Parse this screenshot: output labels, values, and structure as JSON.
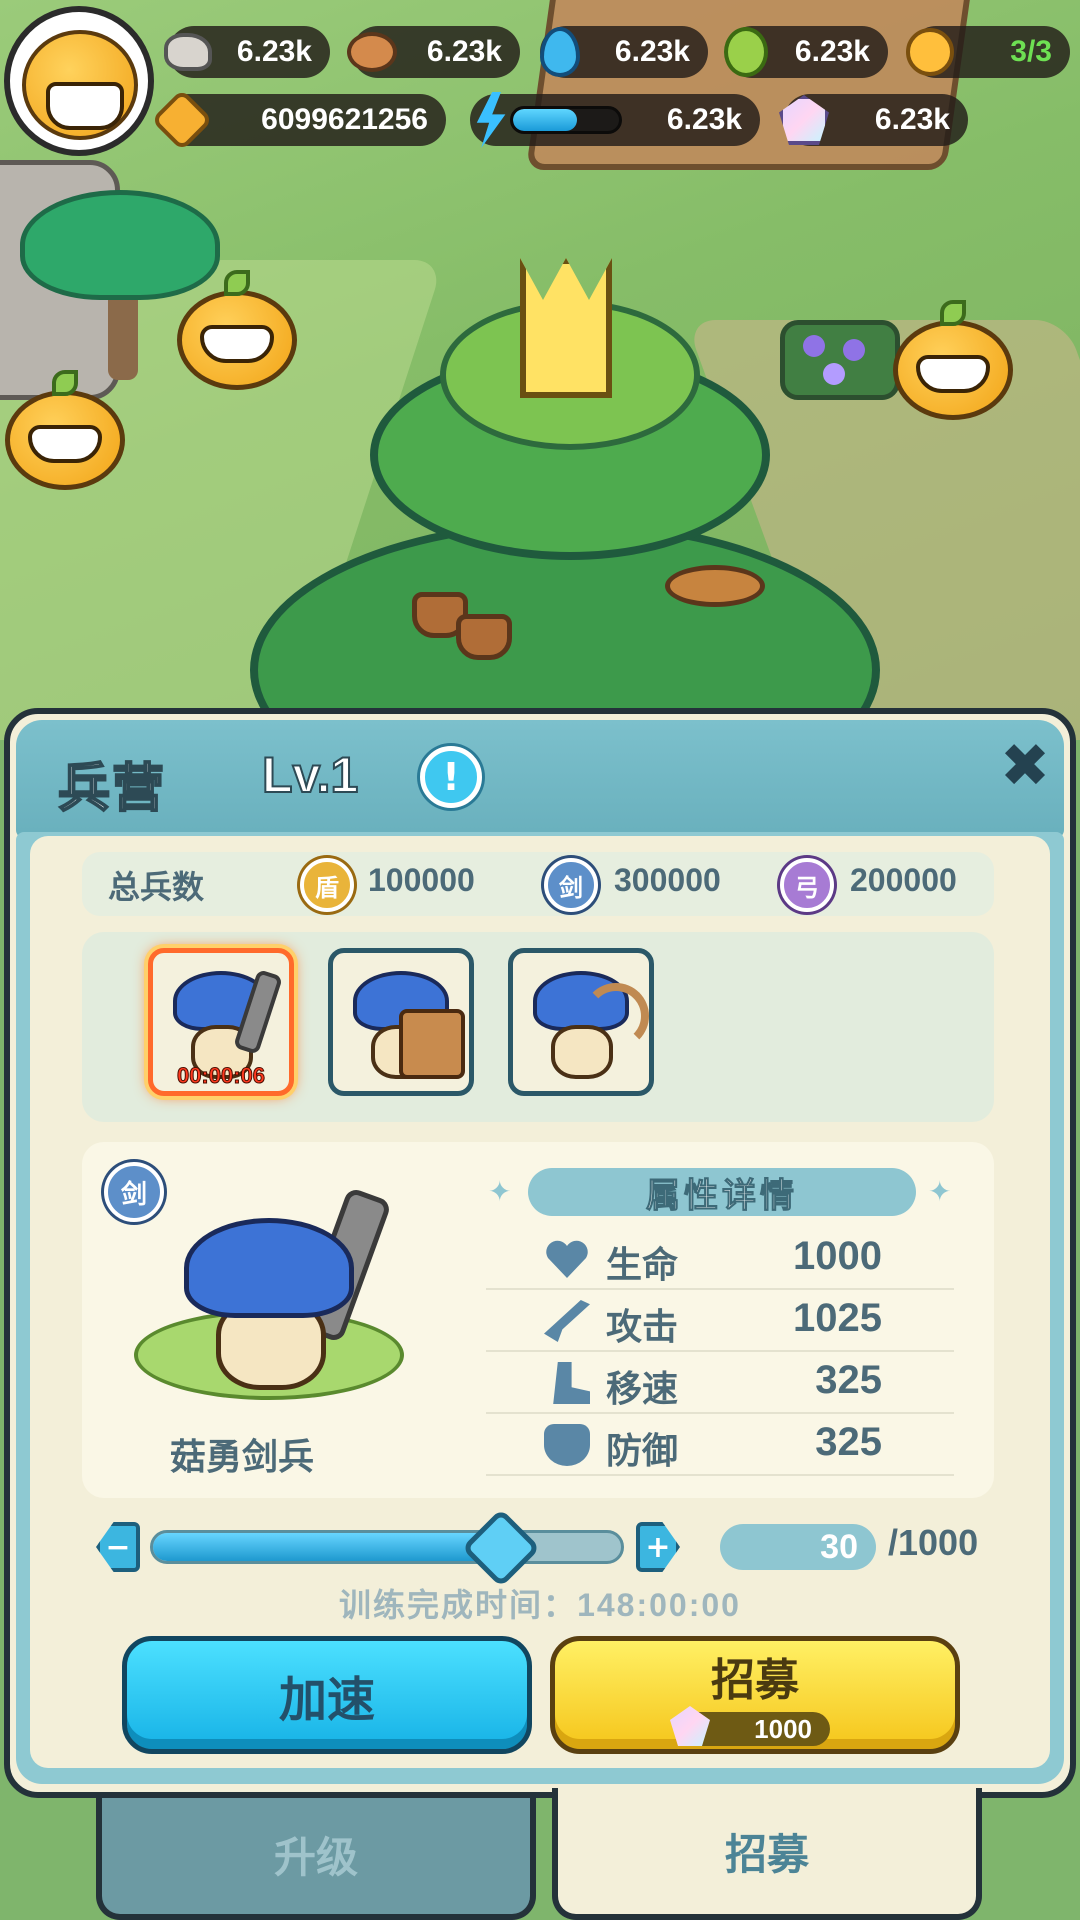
{
  "hud": {
    "resources": [
      {
        "icon": "stone-icon",
        "value": "6.23k"
      },
      {
        "icon": "wood-icon",
        "value": "6.23k"
      },
      {
        "icon": "water-drop-icon",
        "value": "6.23k"
      },
      {
        "icon": "bean-icon",
        "value": "6.23k"
      },
      {
        "icon": "population-icon",
        "value": "3/3"
      }
    ],
    "power": {
      "icon": "crossed-axe-icon",
      "value": "6099621256"
    },
    "energy": {
      "icon": "lightning-icon",
      "value": "6.23k",
      "fill_fraction": 0.6
    },
    "gems": {
      "icon": "gem-icon",
      "value": "6.23k"
    }
  },
  "panel": {
    "title": "兵营",
    "level": "Lv.1",
    "info_glyph": "!",
    "close_glyph": "✖",
    "totals": {
      "label": "总兵数",
      "shield": {
        "badge": "盾",
        "value": "100000"
      },
      "sword": {
        "badge": "剑",
        "value": "300000"
      },
      "bow": {
        "badge": "弓",
        "value": "200000"
      }
    },
    "units": [
      {
        "type": "sword",
        "selected": true,
        "timer": "00:00:06"
      },
      {
        "type": "shield",
        "selected": false
      },
      {
        "type": "bow",
        "selected": false
      }
    ],
    "detail": {
      "type_badge": "剑",
      "unit_name": "菇勇剑兵",
      "attr_title": "属性详情",
      "attributes": [
        {
          "icon": "heart-icon",
          "label": "生命",
          "value": "1000"
        },
        {
          "icon": "sword-icon",
          "label": "攻击",
          "value": "1025"
        },
        {
          "icon": "boot-icon",
          "label": "移速",
          "value": "325"
        },
        {
          "icon": "shield-icon",
          "label": "防御",
          "value": "325"
        }
      ]
    },
    "train": {
      "minus": "−",
      "plus": "+",
      "slider_fraction": 0.74,
      "quantity": "30",
      "max": "/1000",
      "time_label": "训练完成时间：",
      "time_value": "148:00:00"
    },
    "buttons": {
      "speed": "加速",
      "recruit": "招募",
      "recruit_cost": "1000"
    }
  },
  "tabs": {
    "upgrade": "升级",
    "recruit": "招募"
  }
}
